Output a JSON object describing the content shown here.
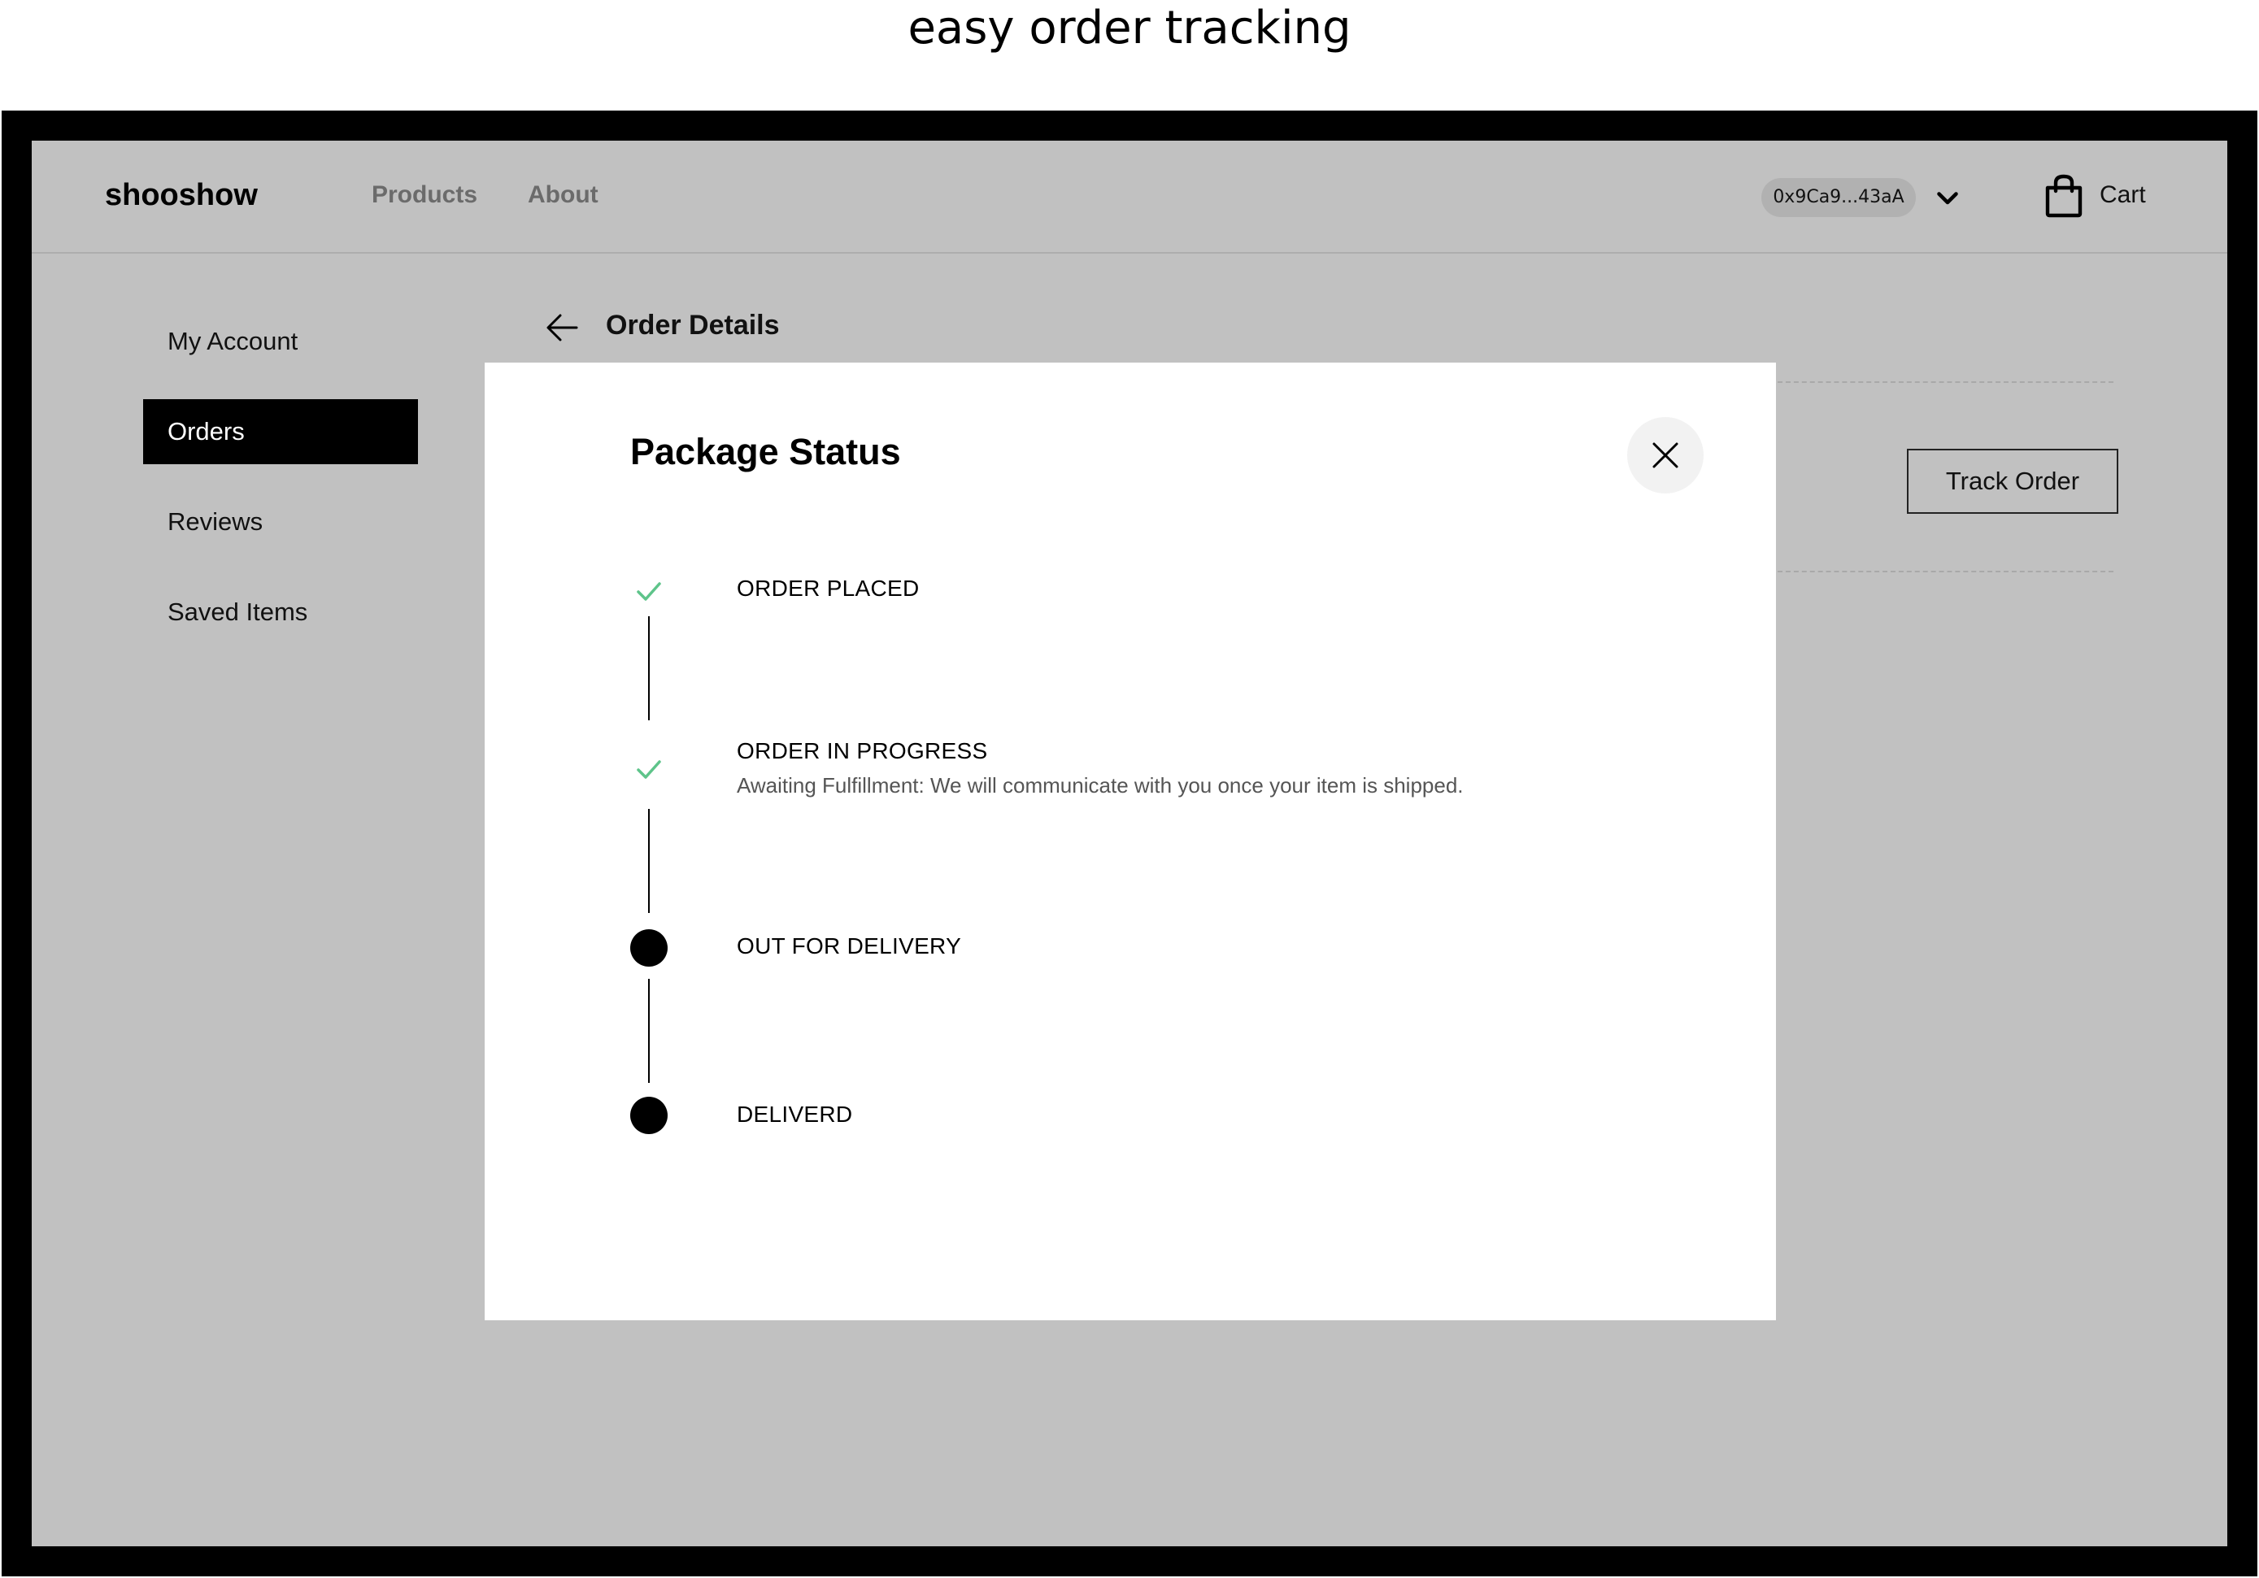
{
  "caption": "easy order tracking",
  "header": {
    "logo": "shooshow",
    "nav": {
      "products": "Products",
      "about": "About"
    },
    "wallet_address": "0x9Ca9...43aA",
    "cart_label": "Cart"
  },
  "sidebar": {
    "items": [
      {
        "label": "My Account",
        "active": false
      },
      {
        "label": "Orders",
        "active": true
      },
      {
        "label": "Reviews",
        "active": false
      },
      {
        "label": "Saved Items",
        "active": false
      }
    ]
  },
  "order": {
    "title": "Order Details",
    "track_button": "Track Order"
  },
  "modal": {
    "title": "Package Status",
    "steps": [
      {
        "label": "ORDER PLACED",
        "status": "done",
        "description": ""
      },
      {
        "label": "ORDER IN PROGRESS",
        "status": "done",
        "description": "Awaiting Fulfillment: We will communicate with you once your item is shipped."
      },
      {
        "label": "OUT FOR DELIVERY",
        "status": "pending",
        "description": ""
      },
      {
        "label": "DELIVERD",
        "status": "pending",
        "description": ""
      }
    ]
  },
  "colors": {
    "check": "#5ec48a",
    "overlay": "#c1c1c1",
    "active_sidebar": "#000000"
  },
  "icons": {
    "back": "arrow-left-icon",
    "close": "close-icon",
    "cart": "shopping-bag-icon",
    "wallet_dropdown": "chevron-down-icon",
    "step_done": "check-icon",
    "step_pending": "dot-icon"
  }
}
